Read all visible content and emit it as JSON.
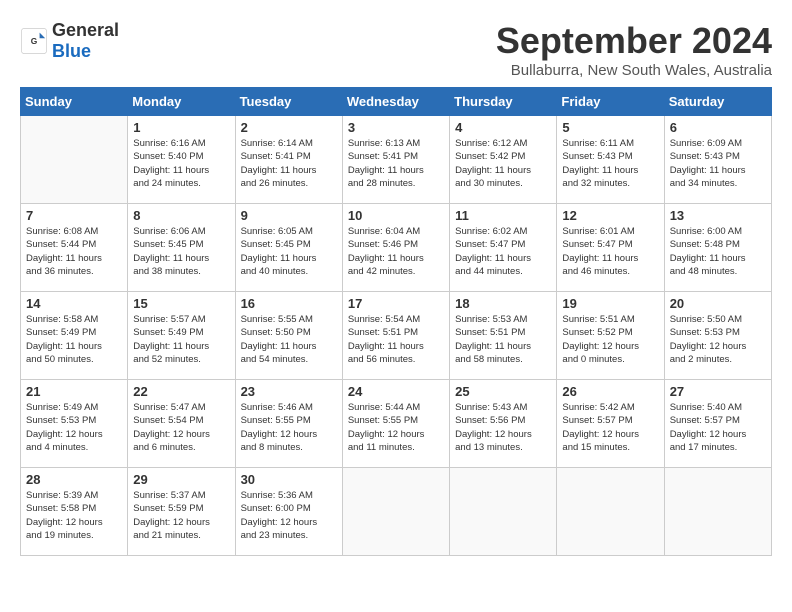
{
  "header": {
    "logo_general": "General",
    "logo_blue": "Blue",
    "month_title": "September 2024",
    "location": "Bullaburra, New South Wales, Australia"
  },
  "weekdays": [
    "Sunday",
    "Monday",
    "Tuesday",
    "Wednesday",
    "Thursday",
    "Friday",
    "Saturday"
  ],
  "days": [
    {
      "day": "",
      "info": ""
    },
    {
      "day": "1",
      "info": "Sunrise: 6:16 AM\nSunset: 5:40 PM\nDaylight: 11 hours\nand 24 minutes."
    },
    {
      "day": "2",
      "info": "Sunrise: 6:14 AM\nSunset: 5:41 PM\nDaylight: 11 hours\nand 26 minutes."
    },
    {
      "day": "3",
      "info": "Sunrise: 6:13 AM\nSunset: 5:41 PM\nDaylight: 11 hours\nand 28 minutes."
    },
    {
      "day": "4",
      "info": "Sunrise: 6:12 AM\nSunset: 5:42 PM\nDaylight: 11 hours\nand 30 minutes."
    },
    {
      "day": "5",
      "info": "Sunrise: 6:11 AM\nSunset: 5:43 PM\nDaylight: 11 hours\nand 32 minutes."
    },
    {
      "day": "6",
      "info": "Sunrise: 6:09 AM\nSunset: 5:43 PM\nDaylight: 11 hours\nand 34 minutes."
    },
    {
      "day": "7",
      "info": "Sunrise: 6:08 AM\nSunset: 5:44 PM\nDaylight: 11 hours\nand 36 minutes."
    },
    {
      "day": "8",
      "info": "Sunrise: 6:06 AM\nSunset: 5:45 PM\nDaylight: 11 hours\nand 38 minutes."
    },
    {
      "day": "9",
      "info": "Sunrise: 6:05 AM\nSunset: 5:45 PM\nDaylight: 11 hours\nand 40 minutes."
    },
    {
      "day": "10",
      "info": "Sunrise: 6:04 AM\nSunset: 5:46 PM\nDaylight: 11 hours\nand 42 minutes."
    },
    {
      "day": "11",
      "info": "Sunrise: 6:02 AM\nSunset: 5:47 PM\nDaylight: 11 hours\nand 44 minutes."
    },
    {
      "day": "12",
      "info": "Sunrise: 6:01 AM\nSunset: 5:47 PM\nDaylight: 11 hours\nand 46 minutes."
    },
    {
      "day": "13",
      "info": "Sunrise: 6:00 AM\nSunset: 5:48 PM\nDaylight: 11 hours\nand 48 minutes."
    },
    {
      "day": "14",
      "info": "Sunrise: 5:58 AM\nSunset: 5:49 PM\nDaylight: 11 hours\nand 50 minutes."
    },
    {
      "day": "15",
      "info": "Sunrise: 5:57 AM\nSunset: 5:49 PM\nDaylight: 11 hours\nand 52 minutes."
    },
    {
      "day": "16",
      "info": "Sunrise: 5:55 AM\nSunset: 5:50 PM\nDaylight: 11 hours\nand 54 minutes."
    },
    {
      "day": "17",
      "info": "Sunrise: 5:54 AM\nSunset: 5:51 PM\nDaylight: 11 hours\nand 56 minutes."
    },
    {
      "day": "18",
      "info": "Sunrise: 5:53 AM\nSunset: 5:51 PM\nDaylight: 11 hours\nand 58 minutes."
    },
    {
      "day": "19",
      "info": "Sunrise: 5:51 AM\nSunset: 5:52 PM\nDaylight: 12 hours\nand 0 minutes."
    },
    {
      "day": "20",
      "info": "Sunrise: 5:50 AM\nSunset: 5:53 PM\nDaylight: 12 hours\nand 2 minutes."
    },
    {
      "day": "21",
      "info": "Sunrise: 5:49 AM\nSunset: 5:53 PM\nDaylight: 12 hours\nand 4 minutes."
    },
    {
      "day": "22",
      "info": "Sunrise: 5:47 AM\nSunset: 5:54 PM\nDaylight: 12 hours\nand 6 minutes."
    },
    {
      "day": "23",
      "info": "Sunrise: 5:46 AM\nSunset: 5:55 PM\nDaylight: 12 hours\nand 8 minutes."
    },
    {
      "day": "24",
      "info": "Sunrise: 5:44 AM\nSunset: 5:55 PM\nDaylight: 12 hours\nand 11 minutes."
    },
    {
      "day": "25",
      "info": "Sunrise: 5:43 AM\nSunset: 5:56 PM\nDaylight: 12 hours\nand 13 minutes."
    },
    {
      "day": "26",
      "info": "Sunrise: 5:42 AM\nSunset: 5:57 PM\nDaylight: 12 hours\nand 15 minutes."
    },
    {
      "day": "27",
      "info": "Sunrise: 5:40 AM\nSunset: 5:57 PM\nDaylight: 12 hours\nand 17 minutes."
    },
    {
      "day": "28",
      "info": "Sunrise: 5:39 AM\nSunset: 5:58 PM\nDaylight: 12 hours\nand 19 minutes."
    },
    {
      "day": "29",
      "info": "Sunrise: 5:37 AM\nSunset: 5:59 PM\nDaylight: 12 hours\nand 21 minutes."
    },
    {
      "day": "30",
      "info": "Sunrise: 5:36 AM\nSunset: 6:00 PM\nDaylight: 12 hours\nand 23 minutes."
    },
    {
      "day": "",
      "info": ""
    },
    {
      "day": "",
      "info": ""
    },
    {
      "day": "",
      "info": ""
    },
    {
      "day": "",
      "info": ""
    },
    {
      "day": "",
      "info": ""
    }
  ]
}
